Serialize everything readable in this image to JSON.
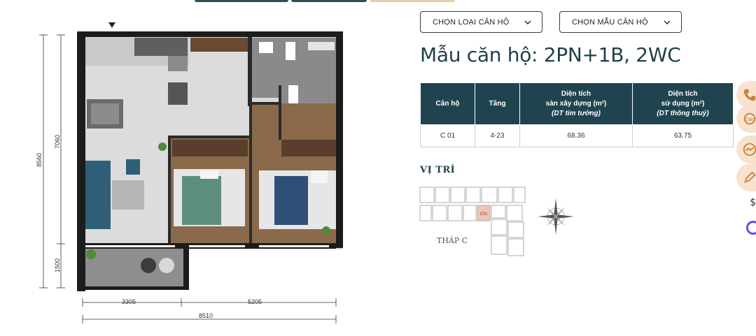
{
  "dropdowns": {
    "apartment_type": "CHỌN LOẠI CĂN HỘ",
    "apartment_model": "CHỌN MẪU CĂN HỘ"
  },
  "title": "Mẫu căn hộ: 2PN+1B, 2WC",
  "table": {
    "headers": {
      "unit": "Căn hộ",
      "floor": "Tầng",
      "built_area_l1": "Diện tích",
      "built_area_l2": "sàn xây dựng (m²)",
      "built_area_l3": "(DT tim tường)",
      "usable_area_l1": "Diện tích",
      "usable_area_l2": "sử dụng (m²)",
      "usable_area_l3": "(DT thông thuỷ)"
    },
    "rows": [
      {
        "unit": "C 01",
        "floor": "4-23",
        "built_area": "68.36",
        "usable_area": "63.75"
      }
    ]
  },
  "location": {
    "title": "VỊ TRÍ",
    "tower": "THÁP C",
    "unit_marker": "C01"
  },
  "plan_dimensions": {
    "left_total": "8560",
    "left_upper": "7060",
    "left_lower": "1500",
    "bottom_left": "3305",
    "bottom_right": "5205",
    "bottom_total": "8510"
  },
  "side_buttons": [
    "phone-icon",
    "chat-icon",
    "messenger-icon",
    "edit-icon"
  ],
  "colors": {
    "primary": "#1f4450",
    "accent": "#f7e3cd",
    "marker": "#f2c4b8"
  }
}
